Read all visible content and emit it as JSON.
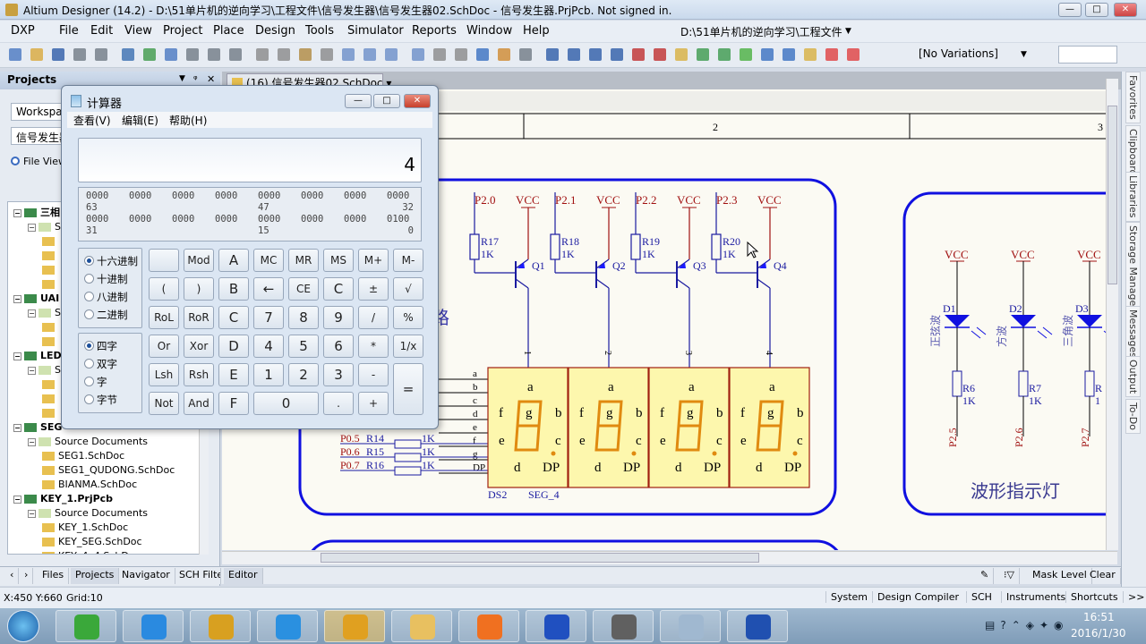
{
  "window": {
    "title": "Altium Designer (14.2) - D:\\51单片机的逆向学习\\工程文件\\信号发生器\\信号发生器02.SchDoc - 信号发生器.PrjPcb. Not signed in.",
    "minimize": "—",
    "maximize": "□",
    "close": "✕"
  },
  "menu": {
    "items": [
      "DXP",
      "File",
      "Edit",
      "View",
      "Project",
      "Place",
      "Design",
      "Tools",
      "Simulator",
      "Reports",
      "Window",
      "Help"
    ],
    "path_combo": "D:\\51单片机的逆向学习\\工程文件"
  },
  "toolbar": {
    "variations": "[No Variations]",
    "icons": [
      "new-icon",
      "open-icon",
      "save-icon",
      "print-icon",
      "print-preview-icon",
      "compile-icon",
      "board-icon",
      "sheet-icon",
      "zoom-fit-icon",
      "zoom-area-icon",
      "zoom-icon",
      "cut-icon",
      "copy-icon",
      "paste-icon",
      "rubber-stamp-icon",
      "select-icon",
      "move-icon",
      "deselect-icon",
      "clear-filter-icon",
      "undo-icon",
      "redo-icon",
      "cross-probe-icon",
      "inspect-icon",
      "browse-icon",
      "wire-icon",
      "bus-icon",
      "bus-entry-icon",
      "net-label-icon",
      "gnd-icon",
      "vcc-icon",
      "part-icon",
      "sheet-symbol-icon",
      "sheet-entry-icon",
      "device-sheet-icon",
      "harness-icon",
      "port-icon",
      "off-sheet-icon",
      "no-erc-icon",
      "compile-mask-icon"
    ],
    "colors": [
      "#4a78c0",
      "#d9a93b",
      "#2e5da8",
      "#707a85",
      "#707a85",
      "#3b6fb0",
      "#3f9a4a",
      "#4a78c0",
      "#707a85",
      "#707a85",
      "#707a85",
      "#8a8a8a",
      "#8a8a8a",
      "#b08a40",
      "#8a8a8a",
      "#6b8fc8",
      "#6b8fc8",
      "#6b8fc8",
      "#6b8fc8",
      "#8a8a8a",
      "#8a8a8a",
      "#3a70c0",
      "#d08a30",
      "#707a85",
      "#2e5da8",
      "#2e5da8",
      "#2e5da8",
      "#2e5da8",
      "#c03030",
      "#c03030",
      "#d8b040",
      "#3c9a4c",
      "#3c9a4c",
      "#4ab040",
      "#3a70c0",
      "#3a70c0",
      "#d8b040",
      "#e04040",
      "#e04040"
    ]
  },
  "projects_panel": {
    "title": "Projects",
    "workspace": "Workspace",
    "project": "信号发生器",
    "view_radio": "File View",
    "tree": [
      {
        "level": 0,
        "type": "project",
        "label": "三相"
      },
      {
        "level": 1,
        "type": "folder",
        "label": "S"
      },
      {
        "level": 2,
        "type": "file",
        "label": ""
      },
      {
        "level": 2,
        "type": "file",
        "label": ""
      },
      {
        "level": 2,
        "type": "file",
        "label": ""
      },
      {
        "level": 2,
        "type": "file",
        "label": ""
      },
      {
        "level": 0,
        "type": "project",
        "label": "UAI"
      },
      {
        "level": 1,
        "type": "folder",
        "label": "S"
      },
      {
        "level": 2,
        "type": "file",
        "label": ""
      },
      {
        "level": 2,
        "type": "file",
        "label": ""
      },
      {
        "level": 0,
        "type": "project",
        "label": "LED"
      },
      {
        "level": 1,
        "type": "folder",
        "label": "S"
      },
      {
        "level": 2,
        "type": "file",
        "label": ""
      },
      {
        "level": 2,
        "type": "file",
        "label": ""
      },
      {
        "level": 2,
        "type": "file",
        "label": ""
      },
      {
        "level": 0,
        "type": "project",
        "label": "SEG"
      },
      {
        "level": 1,
        "type": "folder",
        "label": "Source Documents"
      },
      {
        "level": 2,
        "type": "file",
        "label": "SEG1.SchDoc"
      },
      {
        "level": 2,
        "type": "file",
        "label": "SEG1_QUDONG.SchDoc"
      },
      {
        "level": 2,
        "type": "file",
        "label": "BIANMA.SchDoc"
      },
      {
        "level": 0,
        "type": "project",
        "label": "KEY_1.PrjPcb"
      },
      {
        "level": 1,
        "type": "folder",
        "label": "Source Documents"
      },
      {
        "level": 2,
        "type": "file",
        "label": "KEY_1.SchDoc"
      },
      {
        "level": 2,
        "type": "file",
        "label": "KEY_SEG.SchDoc"
      },
      {
        "level": 2,
        "type": "file",
        "label": "KEY_4x4.SchDoc"
      }
    ]
  },
  "document_tab": "(16) 信号发生器02.SchDoc",
  "schematic": {
    "zone_labels": [
      "2",
      "3"
    ],
    "drivers": [
      {
        "port": "P2.0",
        "vcc": "VCC",
        "res": "R17",
        "value": "1K",
        "transistor": "Q1",
        "pin": "1"
      },
      {
        "port": "P2.1",
        "vcc": "VCC",
        "res": "R18",
        "value": "1K",
        "transistor": "Q2",
        "pin": "2"
      },
      {
        "port": "P2.2",
        "vcc": "VCC",
        "res": "R19",
        "value": "1K",
        "transistor": "Q3",
        "pin": "3"
      },
      {
        "port": "P2.3",
        "vcc": "VCC",
        "res": "R20",
        "value": "1K",
        "transistor": "Q4",
        "pin": "4"
      }
    ],
    "segment_nets": [
      "a",
      "b",
      "c",
      "d",
      "e",
      "f",
      "g",
      "DP"
    ],
    "segment_resistors": [
      {
        "port": "P0.5",
        "res": "R14",
        "value": "1K"
      },
      {
        "port": "P0.6",
        "res": "R15",
        "value": "1K"
      },
      {
        "port": "P0.7",
        "res": "R16",
        "value": "1K"
      }
    ],
    "display": {
      "designator": "DS2",
      "part": "SEG_4",
      "labels": {
        "a": "a",
        "b": "b",
        "c": "c",
        "d": "d",
        "e": "e",
        "f": "f",
        "g": "g",
        "dp": "DP"
      }
    },
    "section_fragment": "路",
    "leds": [
      {
        "vcc": "VCC",
        "designator": "D1",
        "label": "正弦波",
        "res": "R6",
        "value": "1K",
        "port": "P2.5"
      },
      {
        "vcc": "VCC",
        "designator": "D2",
        "label": "方波",
        "res": "R7",
        "value": "1K",
        "port": "P2.6"
      },
      {
        "vcc": "VCC",
        "designator": "D3",
        "label": "三角波",
        "res": "R",
        "value": "1",
        "port": "P2.7"
      }
    ],
    "led_title": "波形指示灯",
    "colors": {
      "wire": "#1a1aa0",
      "net": "#a01010",
      "border": "#1010e0",
      "display_fill": "#fdf7ad",
      "segment": "#e08a10"
    }
  },
  "right_dock": [
    "Favorites",
    "Clipboard",
    "Libraries",
    "Storage Manager",
    "Messages",
    "Output",
    "To-Do"
  ],
  "panel_tabs": {
    "tabs": [
      "Files",
      "Projects",
      "Navigator",
      "SCH Filter"
    ],
    "editor": "Editor",
    "mask_level": "Mask Level",
    "clear": "Clear"
  },
  "status": {
    "coords": "X:450 Y:660",
    "grid": "Grid:10",
    "buttons": [
      "System",
      "Design Compiler",
      "SCH",
      "Instruments",
      "Shortcuts",
      ">>"
    ]
  },
  "taskbar": {
    "apps": [
      "ie-icon",
      "baidu-cloud-icon",
      "altium-icon",
      "feiq-icon",
      "qinheng-mcu-icon",
      "explorer-icon",
      "wps-presentation-icon",
      "network-icon",
      "pcb-tool-icon",
      "calculator-icon",
      "proteus-icon"
    ],
    "colors": [
      "#3aa83a",
      "#2a8ae0",
      "#d8a020",
      "#2a90e0",
      "#e0a020",
      "#e8c060",
      "#f07020",
      "#2050c0",
      "#606060",
      "#a0b8d0",
      "#2050b0"
    ],
    "time": "16:51",
    "date": "2016/1/30"
  },
  "calculator": {
    "title": "计算器",
    "menu": [
      "查看(V)",
      "编辑(E)",
      "帮助(H)"
    ],
    "display": "4",
    "bits": {
      "row1": [
        "0000",
        "0000",
        "0000",
        "0000",
        "0000",
        "0000",
        "0000",
        "0000"
      ],
      "row1_labels": [
        "63",
        "47",
        "32"
      ],
      "row2": [
        "0000",
        "0000",
        "0000",
        "0000",
        "0000",
        "0000",
        "0000",
        "0100"
      ],
      "row2_labels": [
        "31",
        "15",
        "0"
      ]
    },
    "base_options": [
      "十六进制",
      "十进制",
      "八进制",
      "二进制"
    ],
    "base_selected": "十六进制",
    "word_options": [
      "四字",
      "双字",
      "字",
      "字节"
    ],
    "word_selected": "四字",
    "buttons": [
      [
        "",
        "Mod",
        "A",
        "MC",
        "MR",
        "MS",
        "M+",
        "M-"
      ],
      [
        "(",
        ")",
        "B",
        "←",
        "CE",
        "C",
        "±",
        "√"
      ],
      [
        "RoL",
        "RoR",
        "C",
        "7",
        "8",
        "9",
        "/",
        "%"
      ],
      [
        "Or",
        "Xor",
        "D",
        "4",
        "5",
        "6",
        "*",
        "1/x"
      ],
      [
        "Lsh",
        "Rsh",
        "E",
        "1",
        "2",
        "3",
        "-",
        "="
      ],
      [
        "Not",
        "And",
        "F",
        "0",
        ".",
        "+"
      ]
    ]
  }
}
